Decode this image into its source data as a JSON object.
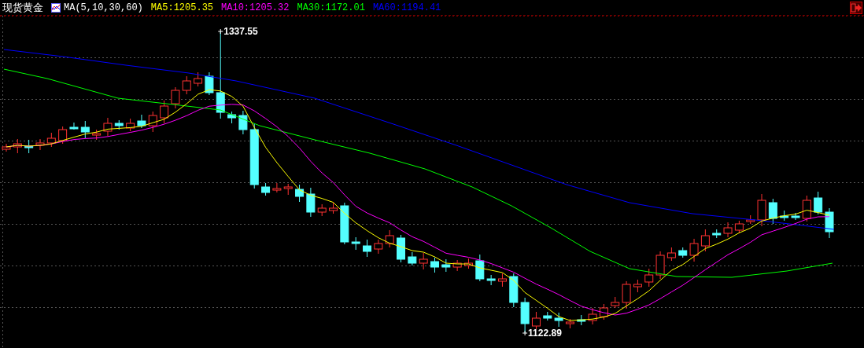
{
  "header": {
    "title": "现货黄金",
    "indicator": "MA(5,10,30,60)",
    "averages": [
      {
        "label": "MA5:1205.35",
        "color": "#ffff00"
      },
      {
        "label": "MA10:1205.32",
        "color": "#ff00ff"
      },
      {
        "label": "MA30:1172.01",
        "color": "#00ff00"
      },
      {
        "label": "MA60:1194.41",
        "color": "#0000ff"
      }
    ]
  },
  "chart": {
    "high_label": "1337.55",
    "low_label": "1122.89"
  }
}
